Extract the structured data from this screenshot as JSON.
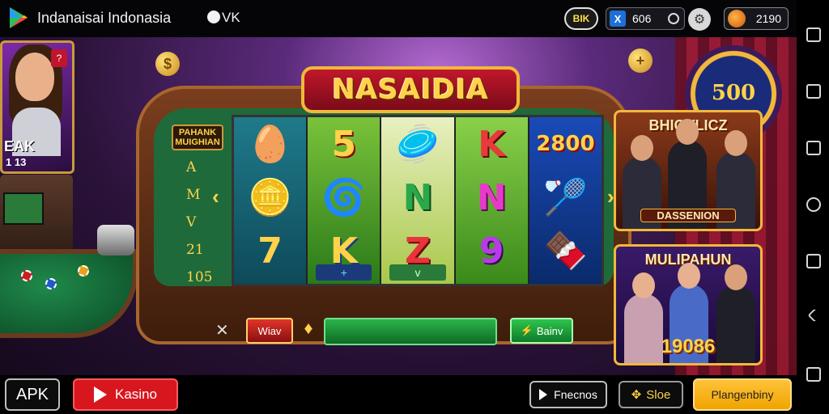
{
  "topbar": {
    "app_title": "Indanaisai Indonasia",
    "vk_label": "VK",
    "bik_label": "BIK",
    "coin_icon": "X",
    "coins_value": "606",
    "gems_value": "2190"
  },
  "scene": {
    "left_card_line1": "EAK",
    "left_card_line2": "1 13",
    "left_card_tag": "?",
    "wheel_label": "500",
    "coin_symbol_left": "$",
    "coin_symbol_right": "+"
  },
  "machine": {
    "title": "NASAIDIA",
    "paytable_head": "PAHANK MUIGHIAN",
    "paytable_values": [
      "A",
      "M",
      "V",
      "21",
      "105"
    ],
    "reels": [
      {
        "symbols": [
          "🥚",
          "🪙",
          "7"
        ],
        "foot": ""
      },
      {
        "symbols": [
          "5",
          "🌀",
          "K"
        ],
        "foot": "+"
      },
      {
        "symbols": [
          "🥏",
          "N",
          "Z"
        ],
        "foot": "v"
      },
      {
        "symbols": [
          "K",
          "N",
          "9"
        ],
        "foot": ""
      },
      {
        "symbols": [
          "2800",
          "🏸",
          "🍫"
        ],
        "foot": ""
      }
    ],
    "red_button": "Wiav",
    "green_button": "Bainv"
  },
  "promos": [
    {
      "title": "BHIOVLICZ",
      "footer": "DASSENION"
    },
    {
      "title": "MULIPAHUN",
      "footer": "19086"
    }
  ],
  "bottombar": {
    "apk_label": "APK",
    "kasino_label": "Kasino",
    "fenecnos_label": "Fnecnos",
    "sloe_label": "Sloe",
    "play_label": "Plangenbiny"
  },
  "colors": {
    "accent_gold": "#f2b83a",
    "kasino_red": "#d8161e",
    "play_orange": "#f0a400"
  }
}
